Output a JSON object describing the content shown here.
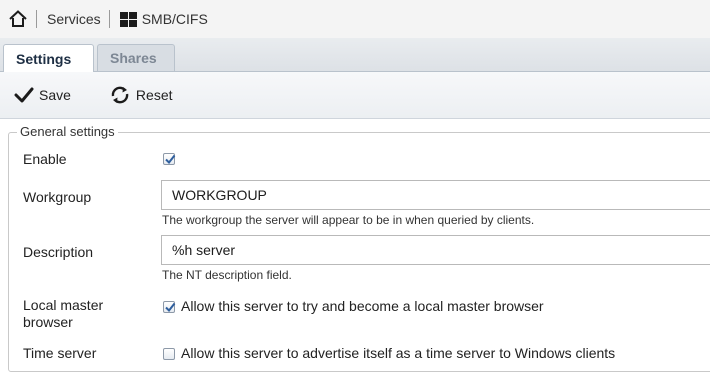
{
  "breadcrumb": {
    "home_icon": "home-icon",
    "items": [
      "Services",
      "SMB/CIFS"
    ],
    "windows_icon": "windows-logo-icon"
  },
  "tabs": [
    {
      "label": "Settings",
      "active": true
    },
    {
      "label": "Shares",
      "active": false
    }
  ],
  "toolbar": {
    "save_label": "Save",
    "reset_label": "Reset"
  },
  "general": {
    "legend": "General settings",
    "enable": {
      "label": "Enable",
      "checked": true
    },
    "workgroup": {
      "label": "Workgroup",
      "value": "WORKGROUP",
      "hint": "The workgroup the server will appear to be in when queried by clients."
    },
    "description": {
      "label": "Description",
      "value": "%h server",
      "hint": "The NT description field."
    },
    "local_master": {
      "label_line1": "Local master",
      "label_line2": "browser",
      "checked": true,
      "text": "Allow this server to try and become a local master browser"
    },
    "time_server": {
      "label": "Time server",
      "checked": false,
      "text": "Allow this server to advertise itself as a time server to Windows clients"
    }
  },
  "colors": {
    "accent_check": "#2f5f9e",
    "tab_active_text": "#1e2f44",
    "tab_inactive_text": "#7d8794"
  }
}
